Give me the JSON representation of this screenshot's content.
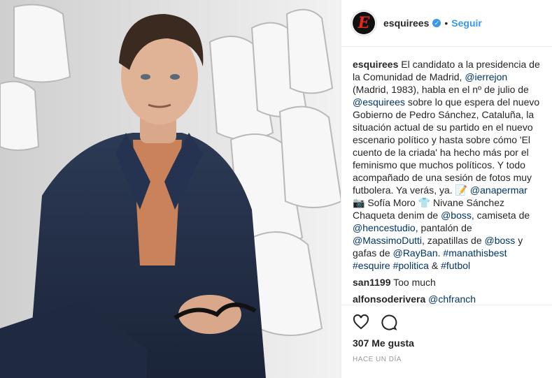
{
  "header": {
    "username": "esquirees",
    "verified_icon": "✓",
    "dot": "•",
    "follow_label": "Seguir",
    "avatar_letter": "E"
  },
  "caption": {
    "username": "esquirees",
    "t1": "El candidato a la presidencia de la Comunidad de Madrid,",
    "m1": "@ierrejon",
    "t2": "(Madrid, 1983), habla en el nº de julio de",
    "m2": "@esquirees",
    "t3": "sobre lo que espera del nuevo Gobierno de Pedro Sánchez, Cataluña, la situación actual de su partido en el nuevo escenario político y hasta sobre cómo 'El cuento de la criada' ha hecho más por el feminismo que muchos políticos. Y todo acompañado de una sesión de fotos muy futbolera. Ya verás, ya.",
    "e1": "📝",
    "m3": "@anapermar",
    "e2": "📷",
    "t4": "Sofía Moro",
    "e3": "👕",
    "t5": "Nivane Sánchez",
    "t6": "Chaqueta denim de",
    "m4": "@boss",
    "t7": ", camiseta de",
    "m5": "@hencestudio",
    "t8": ", pantalón de",
    "m6": "@MassimoDutti",
    "t9": ", zapatillas de",
    "m7": "@boss",
    "t10": "y gafas de",
    "m8": "@RayBan",
    "t11": ".",
    "h1": "#manathisbest",
    "h2": "#esquire",
    "h3": "#politica",
    "t12": "&",
    "h4": "#futbol"
  },
  "comments": [
    {
      "user": "san1199",
      "text": "Too much"
    },
    {
      "user": "alfonsoderivera",
      "mention": "@chfranch"
    }
  ],
  "actions": {
    "like_icon": "heart-icon",
    "comment_icon": "comment-icon"
  },
  "likes_text": "307 Me gusta",
  "time_text": "HACE UN DÍA"
}
